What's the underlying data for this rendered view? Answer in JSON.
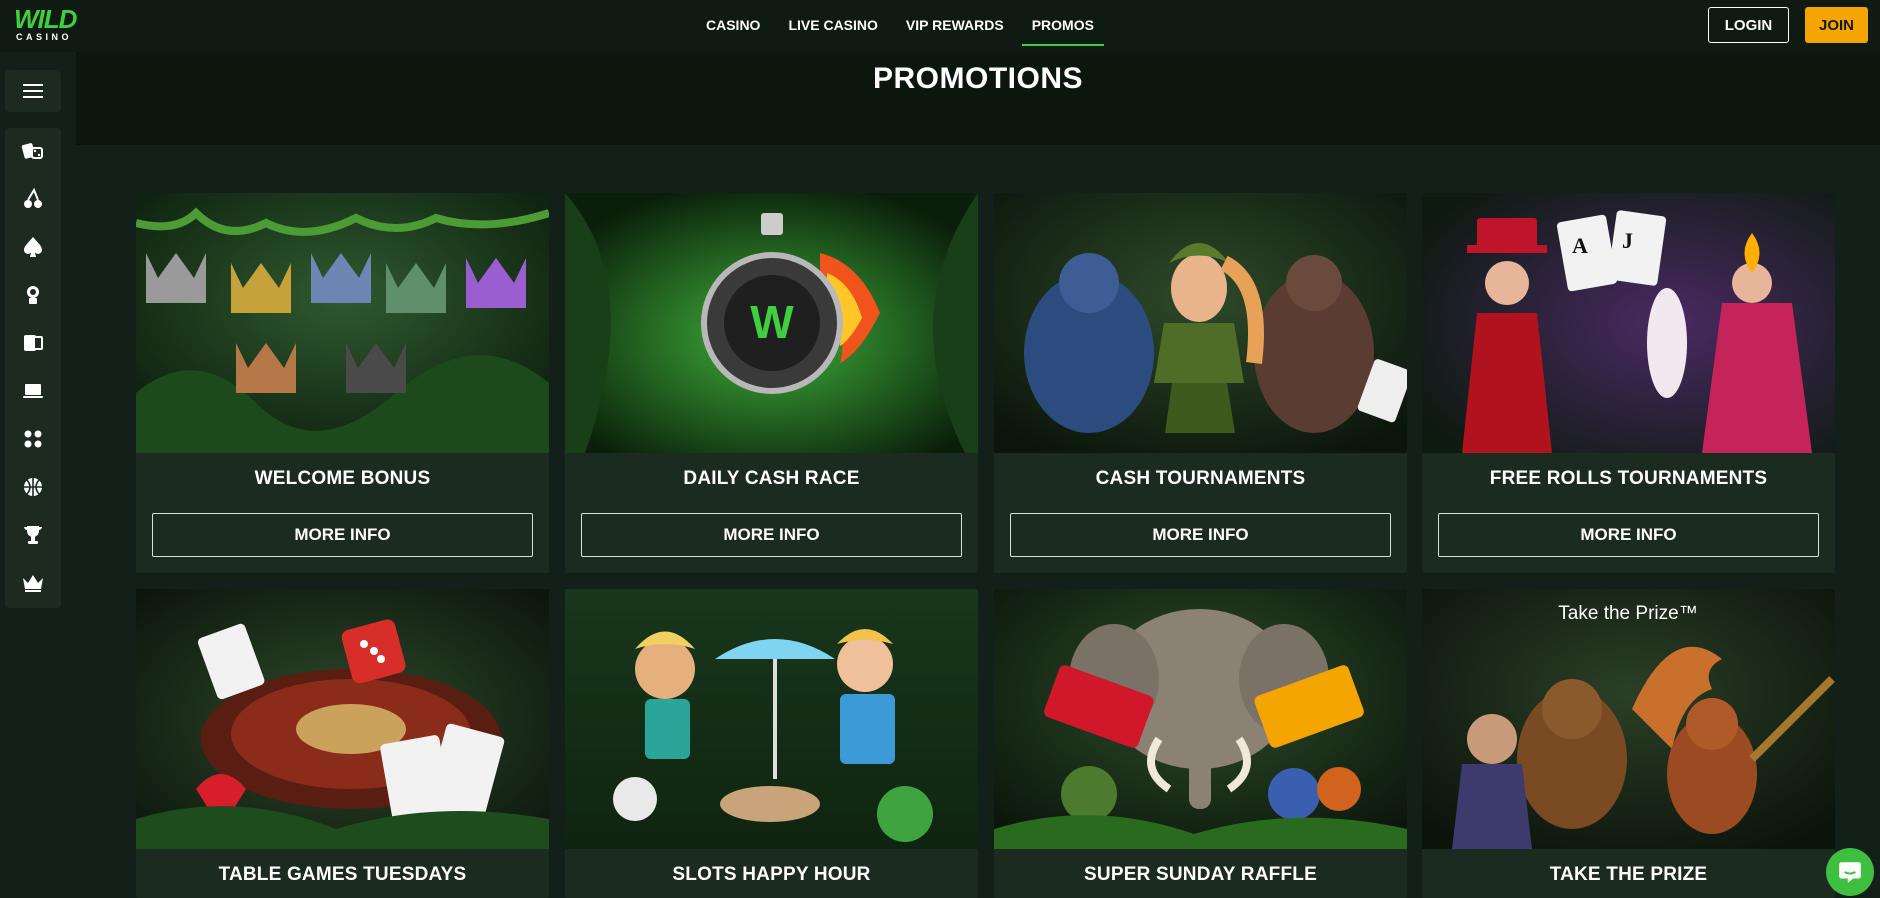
{
  "logo": {
    "line1": "WILD",
    "line2": "CASINO"
  },
  "nav": [
    {
      "label": "CASINO"
    },
    {
      "label": "LIVE CASINO"
    },
    {
      "label": "VIP REWARDS"
    },
    {
      "label": "PROMOS",
      "active": true
    }
  ],
  "auth": {
    "login_label": "LOGIN",
    "join_label": "JOIN"
  },
  "colors": {
    "brand_green": "#3fcf3f",
    "join_yellow": "#f5a500",
    "bg": "#13201a",
    "card": "#1b2b1f"
  },
  "sidebar": {
    "menu_icon": "hamburger-icon",
    "items": [
      {
        "icon": "dice-cards-icon"
      },
      {
        "icon": "cherries-icon"
      },
      {
        "icon": "spade-icon"
      },
      {
        "icon": "dealer-icon"
      },
      {
        "icon": "jackpot-icon"
      },
      {
        "icon": "laptop-icon"
      },
      {
        "icon": "grid-dots-icon"
      },
      {
        "icon": "basketball-icon"
      },
      {
        "icon": "trophy-icon"
      },
      {
        "icon": "crown-icon"
      }
    ]
  },
  "page": {
    "title": "PROMOTIONS"
  },
  "promotions": [
    {
      "title": "WELCOME BONUS",
      "button": "MORE INFO"
    },
    {
      "title": "DAILY CASH RACE",
      "button": "MORE INFO"
    },
    {
      "title": "CASH TOURNAMENTS",
      "button": "MORE INFO"
    },
    {
      "title": "FREE ROLLS TOURNAMENTS",
      "button": "MORE INFO"
    },
    {
      "title": "TABLE GAMES TUESDAYS"
    },
    {
      "title": "SLOTS HAPPY HOUR"
    },
    {
      "title": "SUPER SUNDAY RAFFLE"
    },
    {
      "title": "TAKE THE PRIZE",
      "art_text": "Take the Prize™"
    }
  ],
  "chat": {
    "icon": "chat-icon"
  }
}
